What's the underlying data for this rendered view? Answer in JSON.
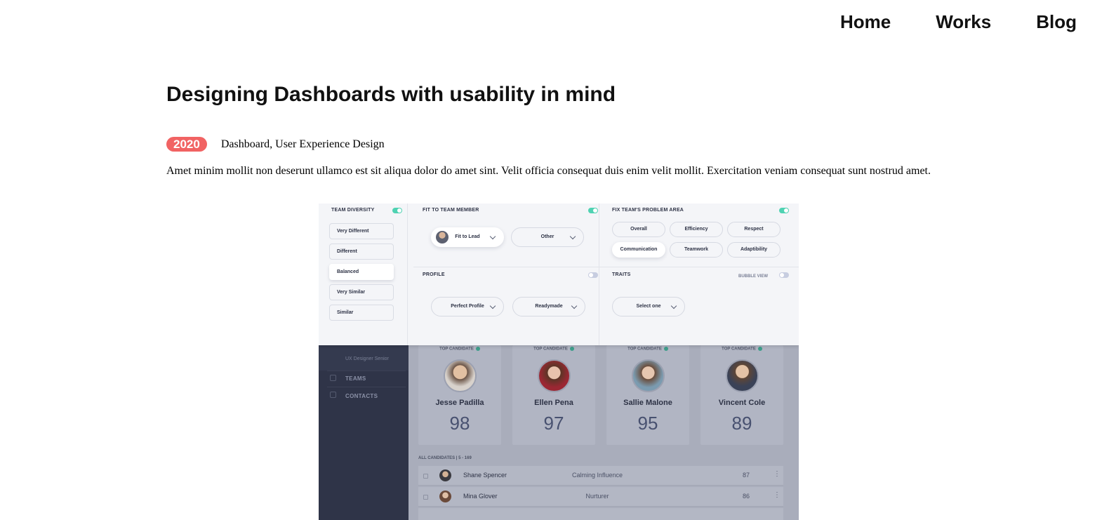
{
  "nav": {
    "home": "Home",
    "works": "Works",
    "blog": "Blog"
  },
  "article": {
    "title": "Designing Dashboards with usability in mind",
    "year": "2020",
    "tags": "Dashboard, User Experience Design",
    "description": "Amet minim mollit non deserunt ullamco est sit aliqua dolor do amet sint. Velit officia consequat duis enim velit mollit. Exercitation veniam consequat sunt nostrud amet."
  },
  "dashboard": {
    "team_diversity": {
      "title": "TEAM DIVERSITY",
      "enabled": true,
      "options": [
        "Very Different",
        "Different",
        "Balanced",
        "Very Similar",
        "Similar"
      ],
      "selected": "Balanced"
    },
    "fit_to_team": {
      "title": "FIT TO TEAM MEMBER",
      "enabled": true,
      "dropdowns": [
        "Fit to Lead",
        "Other"
      ]
    },
    "problem_area": {
      "title": "FIX TEAM'S PROBLEM AREA",
      "enabled": true,
      "pills": [
        "Overall",
        "Efficiency",
        "Respect",
        "Communication",
        "Teamwork",
        "Adaptibility"
      ],
      "selected": "Communication"
    },
    "profile": {
      "title": "PROFILE",
      "enabled": false,
      "dropdowns": [
        "Perfect Profile",
        "Readymade"
      ]
    },
    "traits": {
      "title": "TRAITS",
      "bubble_view": "BUBBLE VIEW",
      "enabled": false,
      "dropdown": "Select one"
    },
    "sidebar": {
      "role": "UX Designer Senior",
      "teams": "TEAMS",
      "contacts": "CONTACTS"
    },
    "top_label": "TOP CANDIDATE",
    "candidates": [
      {
        "name": "Jesse Padilla",
        "score": "98"
      },
      {
        "name": "Ellen Pena",
        "score": "97"
      },
      {
        "name": "Sallie Malone",
        "score": "95"
      },
      {
        "name": "Vincent Cole",
        "score": "89"
      }
    ],
    "all_candidates": "ALL CANDIDATES  |  5 - 169",
    "rows": [
      {
        "name": "Shane Spencer",
        "trait": "Calming Influence",
        "score": "87"
      },
      {
        "name": "Mina Glover",
        "trait": "Nurturer",
        "score": "86"
      }
    ],
    "colors": {
      "accent": "#4fd2b2",
      "badge": "#f16363",
      "sidebar": "#2f3448"
    }
  }
}
